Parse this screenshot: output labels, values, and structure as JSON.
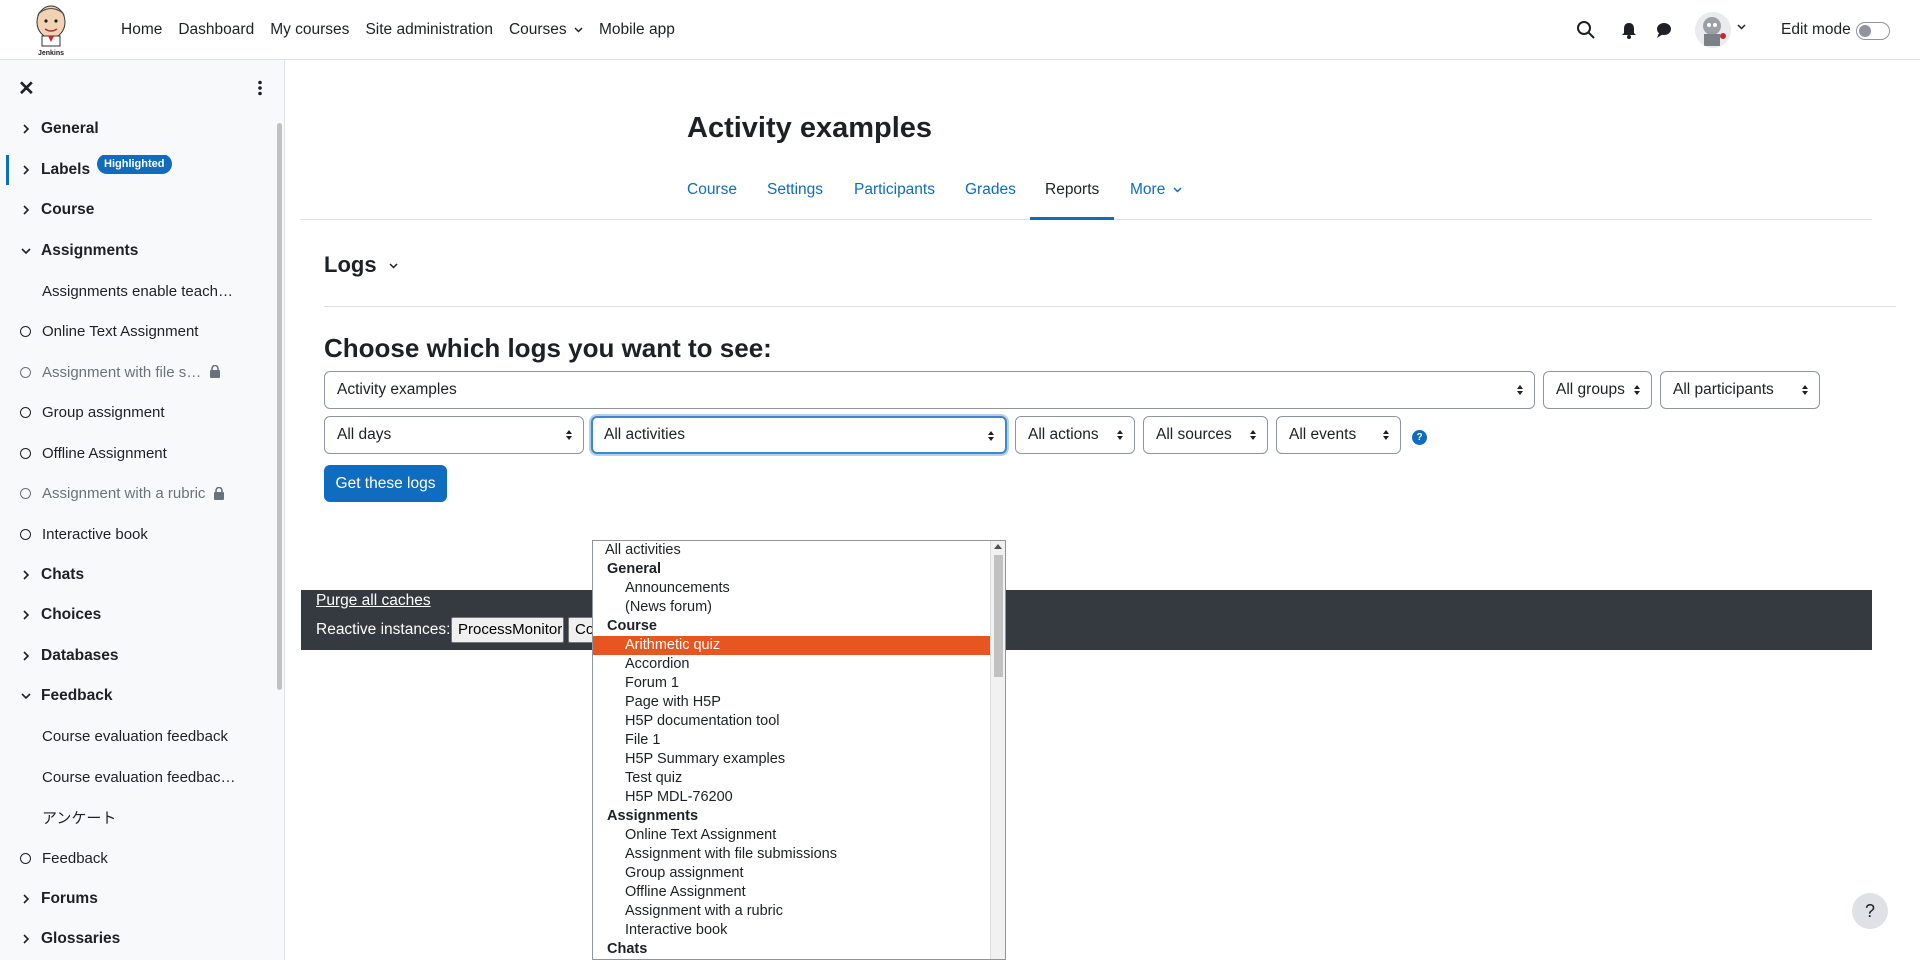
{
  "navbar": {
    "logo_alt": "Jenkins",
    "links": [
      "Home",
      "Dashboard",
      "My courses",
      "Site administration",
      "Courses",
      "Mobile app"
    ],
    "edit_mode_label": "Edit mode"
  },
  "course_index": {
    "items": [
      {
        "type": "section",
        "label": "General",
        "expanded": false
      },
      {
        "type": "section",
        "label": "Labels",
        "expanded": false,
        "badge": "Highlighted",
        "active": true
      },
      {
        "type": "section",
        "label": "Course",
        "expanded": false
      },
      {
        "type": "section",
        "label": "Assignments",
        "expanded": true
      },
      {
        "type": "activity",
        "label": "Assignments enable teach…",
        "indicator": "none"
      },
      {
        "type": "activity",
        "label": "Online Text Assignment",
        "indicator": "circle"
      },
      {
        "type": "activity",
        "label": "Assignment with file s…",
        "indicator": "circle",
        "muted": true,
        "locked": true
      },
      {
        "type": "activity",
        "label": "Group assignment",
        "indicator": "circle"
      },
      {
        "type": "activity",
        "label": "Offline Assignment",
        "indicator": "circle"
      },
      {
        "type": "activity",
        "label": "Assignment with a rubric",
        "indicator": "circle",
        "muted": true,
        "locked": true
      },
      {
        "type": "activity",
        "label": "Interactive book",
        "indicator": "circle"
      },
      {
        "type": "section",
        "label": "Chats",
        "expanded": false
      },
      {
        "type": "section",
        "label": "Choices",
        "expanded": false
      },
      {
        "type": "section",
        "label": "Databases",
        "expanded": false
      },
      {
        "type": "section",
        "label": "Feedback",
        "expanded": true
      },
      {
        "type": "activity",
        "label": "Course evaluation feedback",
        "indicator": "none"
      },
      {
        "type": "activity",
        "label": "Course evaluation feedbac…",
        "indicator": "none"
      },
      {
        "type": "activity",
        "label": "アンケート",
        "indicator": "none"
      },
      {
        "type": "activity",
        "label": "Feedback",
        "indicator": "circle"
      },
      {
        "type": "section",
        "label": "Forums",
        "expanded": false
      },
      {
        "type": "section",
        "label": "Glossaries",
        "expanded": false
      }
    ]
  },
  "page": {
    "title": "Activity examples",
    "secondary_nav": [
      {
        "label": "Course",
        "active": false
      },
      {
        "label": "Settings",
        "active": false
      },
      {
        "label": "Participants",
        "active": false
      },
      {
        "label": "Grades",
        "active": false
      },
      {
        "label": "Reports",
        "active": true
      },
      {
        "label": "More",
        "active": false
      }
    ],
    "tertiary_title": "Logs",
    "heading": "Choose which logs you want to see:"
  },
  "filters": {
    "course": "Activity examples",
    "groups": "All groups",
    "participants": "All participants",
    "days": "All days",
    "activities": "All activities",
    "actions": "All actions",
    "sources": "All sources",
    "events": "All events",
    "help": "?",
    "submit": "Get these logs"
  },
  "devbar": {
    "purge": "Purge all caches",
    "reactive_label": "Reactive instances:",
    "buttons": [
      "ProcessMonitor",
      "Co"
    ]
  },
  "dropdown": {
    "selected": "Arithmetic quiz",
    "rows": [
      {
        "kind": "top",
        "label": "All activities"
      },
      {
        "kind": "group",
        "label": "General"
      },
      {
        "kind": "option",
        "label": "Announcements"
      },
      {
        "kind": "option",
        "label": "(News forum)"
      },
      {
        "kind": "group",
        "label": "Course"
      },
      {
        "kind": "option",
        "label": "Arithmetic quiz"
      },
      {
        "kind": "option",
        "label": "Accordion"
      },
      {
        "kind": "option",
        "label": "Forum 1"
      },
      {
        "kind": "option",
        "label": "Page with H5P"
      },
      {
        "kind": "option",
        "label": "H5P documentation tool"
      },
      {
        "kind": "option",
        "label": "File 1"
      },
      {
        "kind": "option",
        "label": "H5P Summary examples"
      },
      {
        "kind": "option",
        "label": "Test quiz"
      },
      {
        "kind": "option",
        "label": "H5P MDL-76200"
      },
      {
        "kind": "group",
        "label": "Assignments"
      },
      {
        "kind": "option",
        "label": "Online Text Assignment"
      },
      {
        "kind": "option",
        "label": "Assignment with file submissions"
      },
      {
        "kind": "option",
        "label": "Group assignment"
      },
      {
        "kind": "option",
        "label": "Offline Assignment"
      },
      {
        "kind": "option",
        "label": "Assignment with a rubric"
      },
      {
        "kind": "option",
        "label": "Interactive book"
      },
      {
        "kind": "group",
        "label": "Chats"
      }
    ]
  },
  "help_fab": "?",
  "colors": {
    "primary": "#0f6cbf",
    "highlight": "#e8561f",
    "devbar": "#343a40"
  }
}
